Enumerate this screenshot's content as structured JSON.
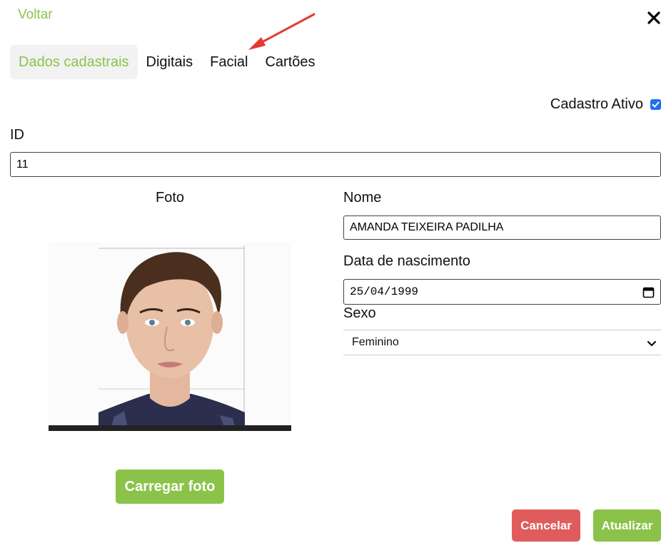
{
  "nav": {
    "back_label": "Voltar"
  },
  "tabs": [
    {
      "label": "Dados cadastrais",
      "active": true
    },
    {
      "label": "Digitais",
      "active": false
    },
    {
      "label": "Facial",
      "active": false
    },
    {
      "label": "Cartões",
      "active": false
    }
  ],
  "form": {
    "active_label": "Cadastro Ativo",
    "active_checked": true,
    "id_label": "ID",
    "id_value": "11",
    "photo_label": "Foto",
    "name_label": "Nome",
    "name_value": "AMANDA TEIXEIRA PADILHA",
    "birth_label": "Data de nascimento",
    "birth_value": "25/04/1999",
    "sex_label": "Sexo",
    "sex_value": "Feminino"
  },
  "buttons": {
    "upload_photo": "Carregar foto",
    "cancel": "Cancelar",
    "update": "Atualizar"
  },
  "colors": {
    "accent": "#8bc34a",
    "cancel": "#e05c5c",
    "checkbox": "#1a73e8",
    "annotation_arrow": "#e53935"
  },
  "icons": {
    "close": "close-icon",
    "calendar": "calendar-icon",
    "chevron": "chevron-down-icon",
    "checkbox": "checkmark-icon"
  }
}
